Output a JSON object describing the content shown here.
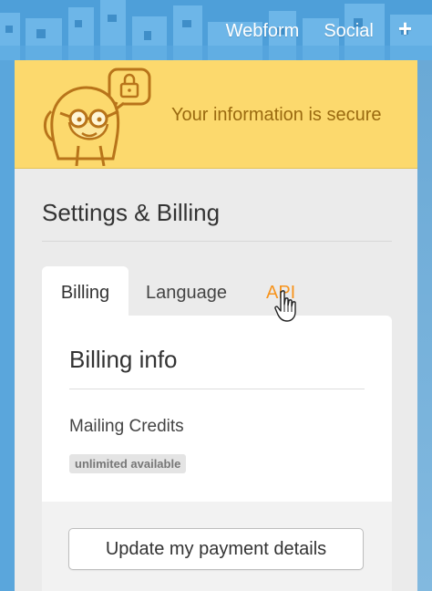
{
  "topnav": {
    "webform": "Webform",
    "social": "Social",
    "add": "+"
  },
  "banner": {
    "message": "Your information is secure",
    "mascot_icon": "mascot-with-lock-icon"
  },
  "settings": {
    "title": "Settings & Billing",
    "tabs": [
      {
        "label": "Billing",
        "active": true
      },
      {
        "label": "Language",
        "active": false
      },
      {
        "label": "API",
        "active": false,
        "hovered": true
      }
    ]
  },
  "billing": {
    "title": "Billing info",
    "mailing_label": "Mailing Credits",
    "badge": "unlimited available",
    "update_button": "Update my payment details"
  },
  "colors": {
    "header_blue": "#4e9fd9",
    "banner_yellow": "#fcd96d",
    "banner_text": "#9a6a10",
    "accent_orange": "#f7941d"
  }
}
